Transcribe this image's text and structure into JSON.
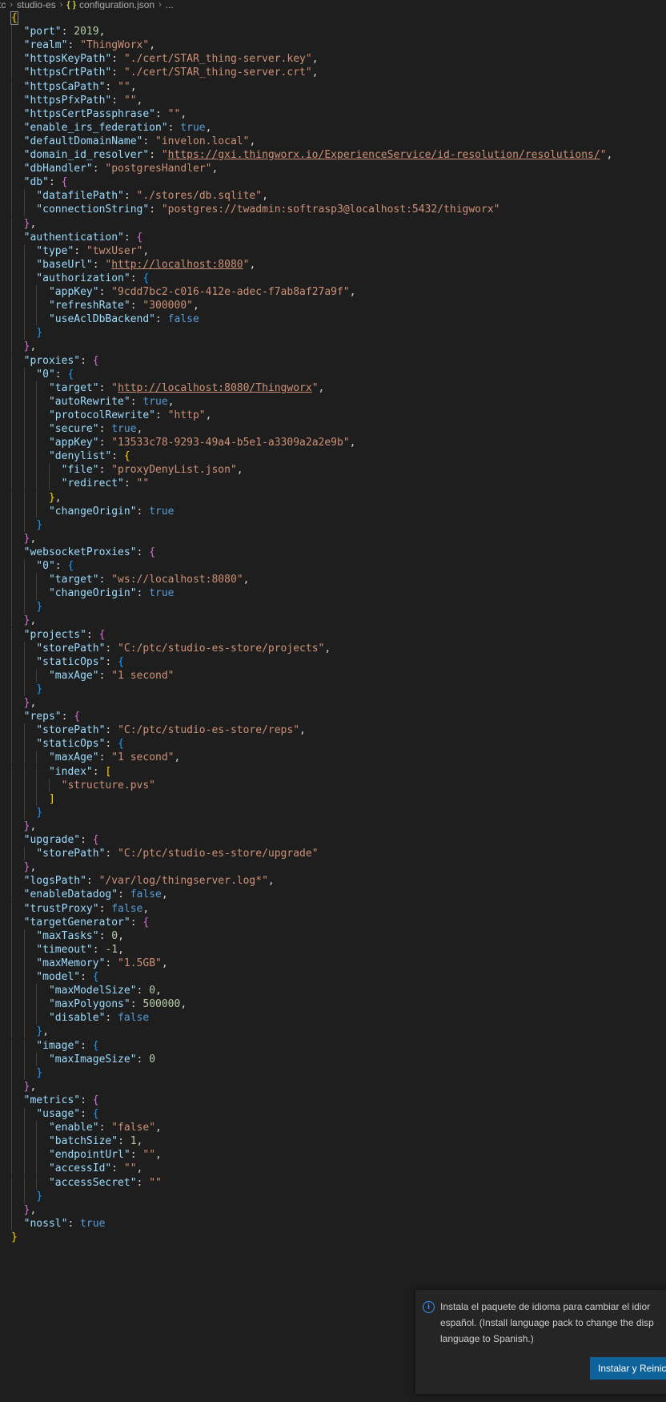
{
  "breadcrumb": {
    "items": [
      "tc",
      "studio-es",
      "configuration.json",
      "..."
    ],
    "file_icon": "{ }"
  },
  "editor": {
    "language": "json",
    "lines": [
      [
        [
          "br0",
          "{"
        ]
      ],
      [
        [
          "k",
          "  \"port\""
        ],
        [
          "p",
          ": "
        ],
        [
          "n",
          "2019"
        ],
        [
          "p",
          ","
        ]
      ],
      [
        [
          "k",
          "  \"realm\""
        ],
        [
          "p",
          ": "
        ],
        [
          "s",
          "\"ThingWorx\""
        ],
        [
          "p",
          ","
        ]
      ],
      [
        [
          "k",
          "  \"httpsKeyPath\""
        ],
        [
          "p",
          ": "
        ],
        [
          "s",
          "\"./cert/STAR_thing-server.key\""
        ],
        [
          "p",
          ","
        ]
      ],
      [
        [
          "k",
          "  \"httpsCrtPath\""
        ],
        [
          "p",
          ": "
        ],
        [
          "s",
          "\"./cert/STAR_thing-server.crt\""
        ],
        [
          "p",
          ","
        ]
      ],
      [
        [
          "k",
          "  \"httpsCaPath\""
        ],
        [
          "p",
          ": "
        ],
        [
          "s",
          "\"\""
        ],
        [
          "p",
          ","
        ]
      ],
      [
        [
          "k",
          "  \"httpsPfxPath\""
        ],
        [
          "p",
          ": "
        ],
        [
          "s",
          "\"\""
        ],
        [
          "p",
          ","
        ]
      ],
      [
        [
          "k",
          "  \"httpsCertPassphrase\""
        ],
        [
          "p",
          ": "
        ],
        [
          "s",
          "\"\""
        ],
        [
          "p",
          ","
        ]
      ],
      [
        [
          "k",
          "  \"enable_irs_federation\""
        ],
        [
          "p",
          ": "
        ],
        [
          "b",
          "true"
        ],
        [
          "p",
          ","
        ]
      ],
      [
        [
          "k",
          "  \"defaultDomainName\""
        ],
        [
          "p",
          ": "
        ],
        [
          "s",
          "\"invelon.local\""
        ],
        [
          "p",
          ","
        ]
      ],
      [
        [
          "k",
          "  \"domain_id_resolver\""
        ],
        [
          "p",
          ": "
        ],
        [
          "s",
          "\""
        ],
        [
          "url",
          "https://gxi.thingworx.io/ExperienceService/id-resolution/resolutions/"
        ],
        [
          "s",
          "\""
        ],
        [
          "p",
          ","
        ]
      ],
      [
        [
          "k",
          "  \"dbHandler\""
        ],
        [
          "p",
          ": "
        ],
        [
          "s",
          "\"postgresHandler\""
        ],
        [
          "p",
          ","
        ]
      ],
      [
        [
          "k",
          "  \"db\""
        ],
        [
          "p",
          ": "
        ],
        [
          "br1",
          "{"
        ]
      ],
      [
        [
          "k",
          "    \"datafilePath\""
        ],
        [
          "p",
          ": "
        ],
        [
          "s",
          "\"./stores/db.sqlite\""
        ],
        [
          "p",
          ","
        ]
      ],
      [
        [
          "k",
          "    \"connectionString\""
        ],
        [
          "p",
          ": "
        ],
        [
          "s",
          "\"postgres://twadmin:softrasp3@localhost:5432/thigworx\""
        ]
      ],
      [
        [
          "p",
          "  "
        ],
        [
          "br1",
          "}"
        ],
        [
          "p",
          ","
        ]
      ],
      [
        [
          "k",
          "  \"authentication\""
        ],
        [
          "p",
          ": "
        ],
        [
          "br1",
          "{"
        ]
      ],
      [
        [
          "k",
          "    \"type\""
        ],
        [
          "p",
          ": "
        ],
        [
          "s",
          "\"twxUser\""
        ],
        [
          "p",
          ","
        ]
      ],
      [
        [
          "k",
          "    \"baseUrl\""
        ],
        [
          "p",
          ": "
        ],
        [
          "s",
          "\""
        ],
        [
          "url",
          "http://localhost:8080"
        ],
        [
          "s",
          "\""
        ],
        [
          "p",
          ","
        ]
      ],
      [
        [
          "k",
          "    \"authorization\""
        ],
        [
          "p",
          ": "
        ],
        [
          "br2",
          "{"
        ]
      ],
      [
        [
          "k",
          "      \"appKey\""
        ],
        [
          "p",
          ": "
        ],
        [
          "s",
          "\"9cdd7bc2-c016-412e-adec-f7ab8af27a9f\""
        ],
        [
          "p",
          ","
        ]
      ],
      [
        [
          "k",
          "      \"refreshRate\""
        ],
        [
          "p",
          ": "
        ],
        [
          "s",
          "\"300000\""
        ],
        [
          "p",
          ","
        ]
      ],
      [
        [
          "k",
          "      \"useAclDbBackend\""
        ],
        [
          "p",
          ": "
        ],
        [
          "b",
          "false"
        ]
      ],
      [
        [
          "p",
          "    "
        ],
        [
          "br2",
          "}"
        ]
      ],
      [
        [
          "p",
          "  "
        ],
        [
          "br1",
          "}"
        ],
        [
          "p",
          ","
        ]
      ],
      [
        [
          "k",
          "  \"proxies\""
        ],
        [
          "p",
          ": "
        ],
        [
          "br1",
          "{"
        ]
      ],
      [
        [
          "k",
          "    \"0\""
        ],
        [
          "p",
          ": "
        ],
        [
          "br2",
          "{"
        ]
      ],
      [
        [
          "k",
          "      \"target\""
        ],
        [
          "p",
          ": "
        ],
        [
          "s",
          "\""
        ],
        [
          "url",
          "http://localhost:8080/Thingworx"
        ],
        [
          "s",
          "\""
        ],
        [
          "p",
          ","
        ]
      ],
      [
        [
          "k",
          "      \"autoRewrite\""
        ],
        [
          "p",
          ": "
        ],
        [
          "b",
          "true"
        ],
        [
          "p",
          ","
        ]
      ],
      [
        [
          "k",
          "      \"protocolRewrite\""
        ],
        [
          "p",
          ": "
        ],
        [
          "s",
          "\"http\""
        ],
        [
          "p",
          ","
        ]
      ],
      [
        [
          "k",
          "      \"secure\""
        ],
        [
          "p",
          ": "
        ],
        [
          "b",
          "true"
        ],
        [
          "p",
          ","
        ]
      ],
      [
        [
          "k",
          "      \"appKey\""
        ],
        [
          "p",
          ": "
        ],
        [
          "s",
          "\"13533c78-9293-49a4-b5e1-a3309a2a2e9b\""
        ],
        [
          "p",
          ","
        ]
      ],
      [
        [
          "k",
          "      \"denylist\""
        ],
        [
          "p",
          ": "
        ],
        [
          "br0",
          "{"
        ]
      ],
      [
        [
          "k",
          "        \"file\""
        ],
        [
          "p",
          ": "
        ],
        [
          "s",
          "\"proxyDenyList.json\""
        ],
        [
          "p",
          ","
        ]
      ],
      [
        [
          "k",
          "        \"redirect\""
        ],
        [
          "p",
          ": "
        ],
        [
          "s",
          "\"\""
        ]
      ],
      [
        [
          "p",
          "      "
        ],
        [
          "br0",
          "}"
        ],
        [
          "p",
          ","
        ]
      ],
      [
        [
          "k",
          "      \"changeOrigin\""
        ],
        [
          "p",
          ": "
        ],
        [
          "b",
          "true"
        ]
      ],
      [
        [
          "p",
          "    "
        ],
        [
          "br2",
          "}"
        ]
      ],
      [
        [
          "p",
          "  "
        ],
        [
          "br1",
          "}"
        ],
        [
          "p",
          ","
        ]
      ],
      [
        [
          "k",
          "  \"websocketProxies\""
        ],
        [
          "p",
          ": "
        ],
        [
          "br1",
          "{"
        ]
      ],
      [
        [
          "k",
          "    \"0\""
        ],
        [
          "p",
          ": "
        ],
        [
          "br2",
          "{"
        ]
      ],
      [
        [
          "k",
          "      \"target\""
        ],
        [
          "p",
          ": "
        ],
        [
          "s",
          "\"ws://localhost:8080\""
        ],
        [
          "p",
          ","
        ]
      ],
      [
        [
          "k",
          "      \"changeOrigin\""
        ],
        [
          "p",
          ": "
        ],
        [
          "b",
          "true"
        ]
      ],
      [
        [
          "p",
          "    "
        ],
        [
          "br2",
          "}"
        ]
      ],
      [
        [
          "p",
          "  "
        ],
        [
          "br1",
          "}"
        ],
        [
          "p",
          ","
        ]
      ],
      [
        [
          "k",
          "  \"projects\""
        ],
        [
          "p",
          ": "
        ],
        [
          "br1",
          "{"
        ]
      ],
      [
        [
          "k",
          "    \"storePath\""
        ],
        [
          "p",
          ": "
        ],
        [
          "s",
          "\"C:/ptc/studio-es-store/projects\""
        ],
        [
          "p",
          ","
        ]
      ],
      [
        [
          "k",
          "    \"staticOps\""
        ],
        [
          "p",
          ": "
        ],
        [
          "br2",
          "{"
        ]
      ],
      [
        [
          "k",
          "      \"maxAge\""
        ],
        [
          "p",
          ": "
        ],
        [
          "s",
          "\"1 second\""
        ]
      ],
      [
        [
          "p",
          "    "
        ],
        [
          "br2",
          "}"
        ]
      ],
      [
        [
          "p",
          "  "
        ],
        [
          "br1",
          "}"
        ],
        [
          "p",
          ","
        ]
      ],
      [
        [
          "k",
          "  \"reps\""
        ],
        [
          "p",
          ": "
        ],
        [
          "br1",
          "{"
        ]
      ],
      [
        [
          "k",
          "    \"storePath\""
        ],
        [
          "p",
          ": "
        ],
        [
          "s",
          "\"C:/ptc/studio-es-store/reps\""
        ],
        [
          "p",
          ","
        ]
      ],
      [
        [
          "k",
          "    \"staticOps\""
        ],
        [
          "p",
          ": "
        ],
        [
          "br2",
          "{"
        ]
      ],
      [
        [
          "k",
          "      \"maxAge\""
        ],
        [
          "p",
          ": "
        ],
        [
          "s",
          "\"1 second\""
        ],
        [
          "p",
          ","
        ]
      ],
      [
        [
          "k",
          "      \"index\""
        ],
        [
          "p",
          ": "
        ],
        [
          "br0",
          "["
        ]
      ],
      [
        [
          "s",
          "        \"structure.pvs\""
        ]
      ],
      [
        [
          "p",
          "      "
        ],
        [
          "br0",
          "]"
        ]
      ],
      [
        [
          "p",
          "    "
        ],
        [
          "br2",
          "}"
        ]
      ],
      [
        [
          "p",
          "  "
        ],
        [
          "br1",
          "}"
        ],
        [
          "p",
          ","
        ]
      ],
      [
        [
          "k",
          "  \"upgrade\""
        ],
        [
          "p",
          ": "
        ],
        [
          "br1",
          "{"
        ]
      ],
      [
        [
          "k",
          "    \"storePath\""
        ],
        [
          "p",
          ": "
        ],
        [
          "s",
          "\"C:/ptc/studio-es-store/upgrade\""
        ]
      ],
      [
        [
          "p",
          "  "
        ],
        [
          "br1",
          "}"
        ],
        [
          "p",
          ","
        ]
      ],
      [
        [
          "k",
          "  \"logsPath\""
        ],
        [
          "p",
          ": "
        ],
        [
          "s",
          "\"/var/log/thingserver.log*\""
        ],
        [
          "p",
          ","
        ]
      ],
      [
        [
          "k",
          "  \"enableDatadog\""
        ],
        [
          "p",
          ": "
        ],
        [
          "b",
          "false"
        ],
        [
          "p",
          ","
        ]
      ],
      [
        [
          "k",
          "  \"trustProxy\""
        ],
        [
          "p",
          ": "
        ],
        [
          "b",
          "false"
        ],
        [
          "p",
          ","
        ]
      ],
      [
        [
          "k",
          "  \"targetGenerator\""
        ],
        [
          "p",
          ": "
        ],
        [
          "br1",
          "{"
        ]
      ],
      [
        [
          "k",
          "    \"maxTasks\""
        ],
        [
          "p",
          ": "
        ],
        [
          "n",
          "0"
        ],
        [
          "p",
          ","
        ]
      ],
      [
        [
          "k",
          "    \"timeout\""
        ],
        [
          "p",
          ": "
        ],
        [
          "n",
          "-1"
        ],
        [
          "p",
          ","
        ]
      ],
      [
        [
          "k",
          "    \"maxMemory\""
        ],
        [
          "p",
          ": "
        ],
        [
          "s",
          "\"1.5GB\""
        ],
        [
          "p",
          ","
        ]
      ],
      [
        [
          "k",
          "    \"model\""
        ],
        [
          "p",
          ": "
        ],
        [
          "br2",
          "{"
        ]
      ],
      [
        [
          "k",
          "      \"maxModelSize\""
        ],
        [
          "p",
          ": "
        ],
        [
          "n",
          "0"
        ],
        [
          "p",
          ","
        ]
      ],
      [
        [
          "k",
          "      \"maxPolygons\""
        ],
        [
          "p",
          ": "
        ],
        [
          "n",
          "500000"
        ],
        [
          "p",
          ","
        ]
      ],
      [
        [
          "k",
          "      \"disable\""
        ],
        [
          "p",
          ": "
        ],
        [
          "b",
          "false"
        ]
      ],
      [
        [
          "p",
          "    "
        ],
        [
          "br2",
          "}"
        ],
        [
          "p",
          ","
        ]
      ],
      [
        [
          "k",
          "    \"image\""
        ],
        [
          "p",
          ": "
        ],
        [
          "br2",
          "{"
        ]
      ],
      [
        [
          "k",
          "      \"maxImageSize\""
        ],
        [
          "p",
          ": "
        ],
        [
          "n",
          "0"
        ]
      ],
      [
        [
          "p",
          "    "
        ],
        [
          "br2",
          "}"
        ]
      ],
      [
        [
          "p",
          "  "
        ],
        [
          "br1",
          "}"
        ],
        [
          "p",
          ","
        ]
      ],
      [
        [
          "k",
          "  \"metrics\""
        ],
        [
          "p",
          ": "
        ],
        [
          "br1",
          "{"
        ]
      ],
      [
        [
          "k",
          "    \"usage\""
        ],
        [
          "p",
          ": "
        ],
        [
          "br2",
          "{"
        ]
      ],
      [
        [
          "k",
          "      \"enable\""
        ],
        [
          "p",
          ": "
        ],
        [
          "s",
          "\"false\""
        ],
        [
          "p",
          ","
        ]
      ],
      [
        [
          "k",
          "      \"batchSize\""
        ],
        [
          "p",
          ": "
        ],
        [
          "n",
          "1"
        ],
        [
          "p",
          ","
        ]
      ],
      [
        [
          "k",
          "      \"endpointUrl\""
        ],
        [
          "p",
          ": "
        ],
        [
          "s",
          "\"\""
        ],
        [
          "p",
          ","
        ]
      ],
      [
        [
          "k",
          "      \"accessId\""
        ],
        [
          "p",
          ": "
        ],
        [
          "s",
          "\"\""
        ],
        [
          "p",
          ","
        ]
      ],
      [
        [
          "k",
          "      \"accessSecret\""
        ],
        [
          "p",
          ": "
        ],
        [
          "s",
          "\"\""
        ]
      ],
      [
        [
          "p",
          "    "
        ],
        [
          "br2",
          "}"
        ]
      ],
      [
        [
          "p",
          "  "
        ],
        [
          "br1",
          "}"
        ],
        [
          "p",
          ","
        ]
      ],
      [
        [
          "k",
          "  \"nossl\""
        ],
        [
          "p",
          ": "
        ],
        [
          "b",
          "true"
        ]
      ],
      [
        [
          "br0",
          "}"
        ]
      ]
    ]
  },
  "notification": {
    "icon": "info-icon",
    "message_lines": [
      "Instala el paquete de idioma para cambiar el idior",
      "español. (Install language pack to change the disp",
      "language to Spanish.)"
    ],
    "button_label": "Instalar y Reinic"
  },
  "colors": {
    "background": "#1e1e1e",
    "key": "#9cdcfe",
    "string": "#ce9178",
    "number": "#b5cea8",
    "boolean": "#569cd6",
    "bracket_level_0": "#ffd700",
    "bracket_level_1": "#da70d6",
    "bracket_level_2": "#179fff",
    "button": "#0e639c"
  }
}
